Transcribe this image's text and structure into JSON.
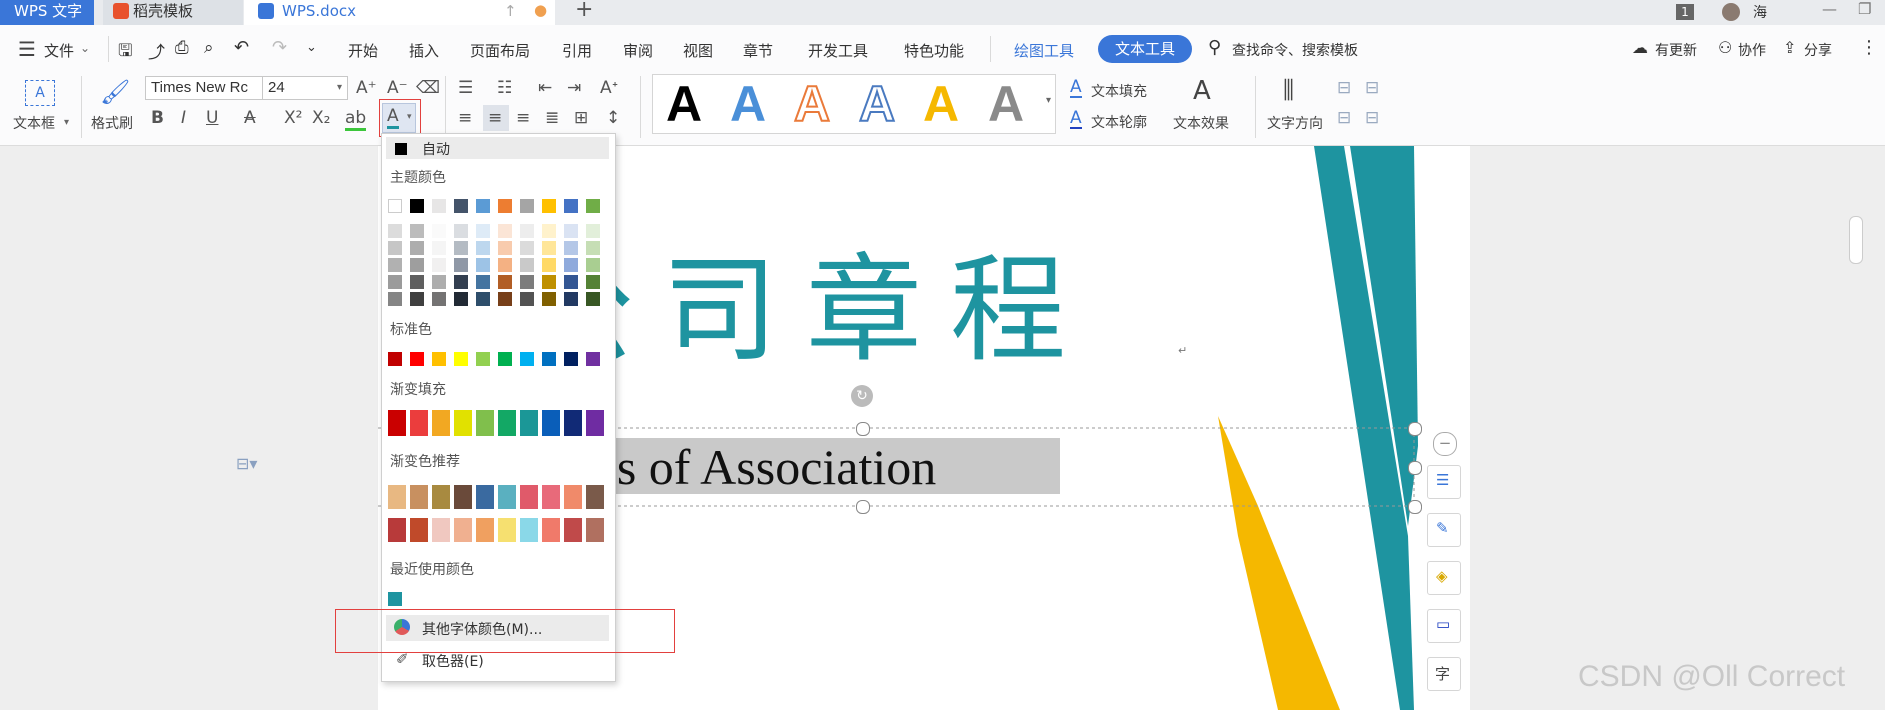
{
  "titlebar": {
    "tab_app": "WPS 文字",
    "tab_template": "稻壳模板",
    "tab_doc": "WPS.docx",
    "page_badge": "1",
    "user_name": "海"
  },
  "menubar": {
    "file_label": "文件",
    "items": [
      "开始",
      "插入",
      "页面布局",
      "引用",
      "审阅",
      "视图",
      "章节",
      "开发工具",
      "特色功能"
    ],
    "drawing_tools": "绘图工具",
    "text_tools": "文本工具",
    "search_label": "查找命令、搜索模板",
    "update_label": "有更新",
    "collab_label": "协作",
    "share_label": "分享"
  },
  "ribbon": {
    "textbox_label": "文本框",
    "format_painter_label": "格式刷",
    "font_name": "Times New Rc",
    "font_size": "24",
    "text_fill": "文本填充",
    "text_outline": "文本轮廓",
    "text_effect": "文本效果",
    "text_direction": "文字方向",
    "wordart_styles": [
      "A",
      "A",
      "A",
      "A",
      "A",
      "A"
    ]
  },
  "document": {
    "title_text": "公司章程",
    "subtitle_text": "Articles of Association",
    "title_color": "#1e94a0"
  },
  "color_menu": {
    "auto_label": "自动",
    "theme_label": "主题颜色",
    "standard_label": "标准色",
    "gradient_fill_label": "渐变填充",
    "gradient_recommend_label": "渐变色推荐",
    "recent_label": "最近使用颜色",
    "more_colors_label": "其他字体颜色(M)...",
    "eyedropper_label": "取色器(E)",
    "theme_top_row": [
      "#ffffff",
      "#000000",
      "#e7e6e6",
      "#44546a",
      "#5b9bd5",
      "#ed7d31",
      "#a5a5a5",
      "#ffc000",
      "#4472c4",
      "#70ad47"
    ],
    "standard_colors": [
      "#c00000",
      "#ff0000",
      "#ffc000",
      "#ffff00",
      "#92d050",
      "#00b050",
      "#00b0f0",
      "#0070c0",
      "#002060",
      "#7030a0"
    ],
    "gradient_fill_colors": [
      "#c00000",
      "#e03a3a",
      "#e6a020",
      "#d6d600",
      "#7ab648",
      "#12a060",
      "#1a9090",
      "#0a5ab0",
      "#102870",
      "#6a2a9a"
    ],
    "gradient_recommend_row1": [
      "#e8b882",
      "#c89060",
      "#a88a40",
      "#6a4a3a",
      "#3a6aa0",
      "#5ab0c0",
      "#e05a6a",
      "#e86a7a",
      "#f08a6a",
      "#7a5a4a"
    ],
    "gradient_recommend_row2": [
      "#b83a3a",
      "#c04a2a",
      "#f0c8c0",
      "#f0b090",
      "#f0a060",
      "#f6e070",
      "#8ad8e8",
      "#f07a6a",
      "#c04a4a",
      "#b07060"
    ],
    "recent_colors": [
      "#1e94a0"
    ]
  },
  "watermark": "CSDN @Oll Correct"
}
